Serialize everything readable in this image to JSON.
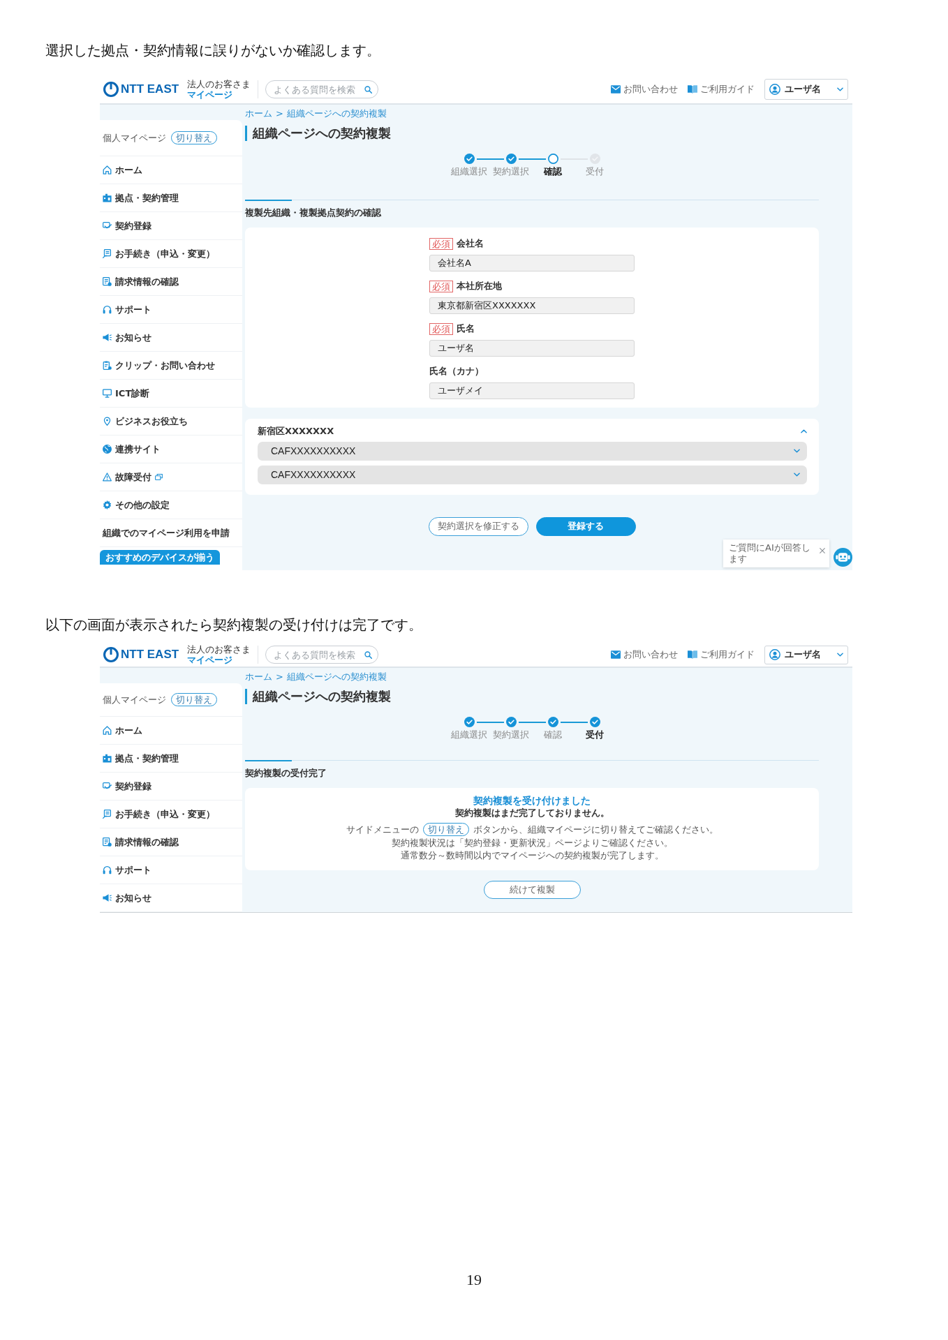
{
  "sections": [
    {
      "caption": "選択した拠点・契約情報に誤りがないか確認します。",
      "screen": {
        "header": {
          "logo": "NTT EAST",
          "service_name": "法人のお客さま",
          "service_subtitle": "マイページ",
          "search": {
            "placeholder": "よくある質問を検索"
          },
          "links": [
            {
              "label": "お問い合わせ"
            },
            {
              "label": "ご利用ガイド"
            }
          ],
          "user_menu": {
            "label": "ユーザ名"
          }
        },
        "sidebar": {
          "account": {
            "label": "個人マイページ",
            "switch_label": "切り替え"
          },
          "items": [
            {
              "label": "ホーム",
              "kind": "menu",
              "external": false
            },
            {
              "label": "拠点・契約管理",
              "kind": "menu",
              "external": false
            },
            {
              "label": "契約登録",
              "kind": "menu",
              "external": false
            },
            {
              "label": "お手続き（申込・変更）",
              "kind": "menu",
              "external": false
            },
            {
              "label": "請求情報の確認",
              "kind": "menu",
              "external": false
            },
            {
              "label": "サポート",
              "kind": "menu",
              "external": false
            },
            {
              "label": "お知らせ",
              "kind": "menu",
              "external": false
            },
            {
              "label": "クリップ・お問い合わせ",
              "kind": "menu",
              "external": false
            },
            {
              "label": "ICT診断",
              "kind": "menu",
              "external": false
            },
            {
              "label": "ビジネスお役立ち",
              "kind": "menu",
              "external": false
            },
            {
              "label": "連携サイト",
              "kind": "menu",
              "external": false
            },
            {
              "label": "故障受付",
              "kind": "menu",
              "external": true
            },
            {
              "label": "その他の設定",
              "kind": "menu",
              "external": false
            },
            {
              "label": "組織でのマイページ利用を申請",
              "kind": "text",
              "external": false
            },
            {
              "label": "おすすめのデバイスが揃う",
              "kind": "banner",
              "external": false
            }
          ]
        },
        "breadcrumb": {
          "items": [
            {
              "label": "ホーム"
            },
            {
              "label": "組織ページへの契約複製"
            }
          ],
          "separator": ">"
        },
        "title": "組織ページへの契約複製",
        "steps": [
          {
            "label": "組織選択",
            "completed": true,
            "selected": false
          },
          {
            "label": "契約選択",
            "completed": true,
            "selected": false
          },
          {
            "label": "確認",
            "completed": false,
            "selected": true
          },
          {
            "label": "受付",
            "completed": false,
            "selected": false
          }
        ],
        "section_title": "複製先組織・複製拠点契約の確認",
        "content": {
          "kind": "confirm",
          "fields": [
            {
              "badge": "必須",
              "label": "会社名",
              "value": "会社名A"
            },
            {
              "badge": "必須",
              "label": "本社所在地",
              "value": "東京都新宿区XXXXXXX"
            },
            {
              "badge": "必須",
              "label": "氏名",
              "value": "ユーザ名"
            },
            {
              "label": "氏名（カナ）",
              "value": "ユーザメイ"
            }
          ],
          "contract_group": {
            "title": "新宿区XXXXXXX",
            "expanded": true,
            "contracts": [
              {
                "label": "CAFXXXXXXXXXX",
                "expanded": false
              },
              {
                "label": "CAFXXXXXXXXXX",
                "expanded": false
              }
            ]
          },
          "buttons": [
            {
              "label": "契約選択を修正する",
              "kind": "secondary"
            },
            {
              "label": "登録する",
              "kind": "primary"
            }
          ]
        },
        "chat_popup": {
          "message": "ご質問にAIが回答します"
        }
      }
    },
    {
      "caption": "以下の画面が表示されたら契約複製の受け付けは完了です。",
      "screen": {
        "header": {
          "logo": "NTT EAST",
          "service_name": "法人のお客さま",
          "service_subtitle": "マイページ",
          "search": {
            "placeholder": "よくある質問を検索"
          },
          "links": [
            {
              "label": "お問い合わせ"
            },
            {
              "label": "ご利用ガイド"
            }
          ],
          "user_menu": {
            "label": "ユーザ名"
          }
        },
        "sidebar": {
          "account": {
            "label": "個人マイページ",
            "switch_label": "切り替え"
          },
          "items": [
            {
              "label": "ホーム",
              "kind": "menu",
              "external": false
            },
            {
              "label": "拠点・契約管理",
              "kind": "menu",
              "external": false
            },
            {
              "label": "契約登録",
              "kind": "menu",
              "external": false
            },
            {
              "label": "お手続き（申込・変更）",
              "kind": "menu",
              "external": false
            },
            {
              "label": "請求情報の確認",
              "kind": "menu",
              "external": false
            },
            {
              "label": "サポート",
              "kind": "menu",
              "external": false
            },
            {
              "label": "お知らせ",
              "kind": "menu",
              "external": false
            }
          ]
        },
        "breadcrumb": {
          "items": [
            {
              "label": "ホーム"
            },
            {
              "label": "組織ページへの契約複製"
            }
          ],
          "separator": ">"
        },
        "title": "組織ページへの契約複製",
        "steps": [
          {
            "label": "組織選択",
            "completed": true,
            "selected": false
          },
          {
            "label": "契約選択",
            "completed": true,
            "selected": false
          },
          {
            "label": "確認",
            "completed": true,
            "selected": false
          },
          {
            "label": "受付",
            "completed": true,
            "selected": true
          }
        ],
        "section_title": "契約複製の受付完了",
        "content": {
          "kind": "complete",
          "message": {
            "heading": "契約複製を受け付けました",
            "subheading": "契約複製はまだ完了しておりません。",
            "switch_note": {
              "before": "サイドメニューの",
              "pill": "切り替え",
              "after": "ボタンから、組織マイページに切り替えてご確認ください。"
            },
            "lines": [
              "契約複製状況は「契約登録・更新状況」ページよりご確認ください。",
              "通常数分～数時間以内でマイページへの契約複製が完了します。"
            ]
          },
          "buttons": [
            {
              "label": "続けて複製",
              "kind": "secondary"
            }
          ]
        }
      }
    }
  ],
  "page_number": "19"
}
